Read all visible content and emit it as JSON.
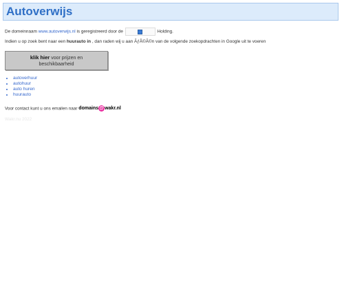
{
  "header": {
    "title": "Autoverwijs"
  },
  "intro": {
    "pre": "De domeinnaam",
    "domain_link": "www.autoverwijs.nl",
    "mid": "is geregistreerd door de",
    "holding": "Holding."
  },
  "search_line": {
    "pre": "Indien u op zoek bent naar een",
    "term": "huurauto in",
    "post": ", dan raden wij u aan ÃƒÂ©Ã©n van de volgende zoekopdrachten in Google uit te voeren"
  },
  "cta": {
    "bold": "klik hier",
    "rest1": "voor prijzen en",
    "rest2": "beschikbaarheid"
  },
  "links": [
    "autoverhuur",
    "autohuur",
    "auto huren",
    "huurauto"
  ],
  "contact": {
    "pre": "Voor contact kunt u ons emailen naar",
    "user": "domains",
    "at": "@",
    "domain": "wakr.nl"
  },
  "faint_text": "Wakr.nu 2022",
  "colors": {
    "accent": "#2f6fc6",
    "header_bg": "#dcebfb",
    "link": "#3366cc",
    "at_badge": "#e8209a"
  }
}
